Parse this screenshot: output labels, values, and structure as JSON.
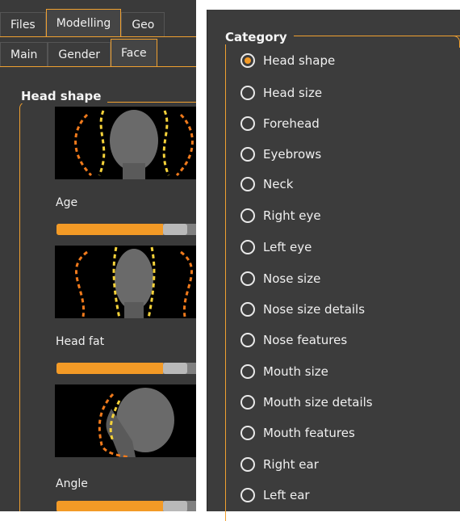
{
  "top_tabs": [
    "Files",
    "Modelling",
    "Geo"
  ],
  "sub_tabs": [
    "Main",
    "Gender",
    "Face"
  ],
  "group": {
    "title": "Head shape",
    "sliders": [
      {
        "label": "Age",
        "value": 0.66
      },
      {
        "label": "Head fat",
        "value": 0.66
      },
      {
        "label": "Angle",
        "value": 0.66
      }
    ]
  },
  "category": {
    "title": "Category",
    "selected": "Head shape",
    "items": [
      "Head shape",
      "Head size",
      "Forehead",
      "Eyebrows",
      "Neck",
      "Right eye",
      "Left eye",
      "Nose size",
      "Nose size details",
      "Nose features",
      "Mouth size",
      "Mouth size details",
      "Mouth features",
      "Right ear",
      "Left ear"
    ]
  },
  "colors": {
    "accent": "#f39a26",
    "panel": "#3a3a3a"
  }
}
